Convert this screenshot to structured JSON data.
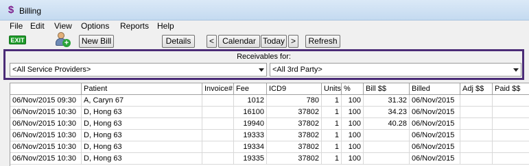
{
  "window": {
    "title": "Billing",
    "icon": "dollar-icon"
  },
  "menu": [
    "File",
    "Edit",
    "View",
    "Options",
    "Reports",
    "Help"
  ],
  "toolbar": {
    "exit_label": "EXIT",
    "new_bill": "New Bill",
    "details": "Details",
    "prev": "<",
    "calendar": "Calendar",
    "today": "Today",
    "next": ">",
    "refresh": "Refresh"
  },
  "filters": {
    "title": "Receivables for:",
    "providers": "<All Service Providers>",
    "third_party": "<All 3rd Party>"
  },
  "colors": {
    "highlight_border": "#4b2c77",
    "exit_green": "#1e9b2a"
  },
  "table": {
    "columns": [
      "",
      "Patient",
      "Invoice#",
      "Fee",
      "ICD9",
      "Units",
      "%",
      "Bill $$",
      "Billed",
      "Adj $$",
      "Paid $$"
    ],
    "rows": [
      [
        "06/Nov/2015 09:30",
        "A, Caryn 67",
        "",
        "1012",
        "780",
        "1",
        "100",
        "31.32",
        "06/Nov/2015",
        "",
        ""
      ],
      [
        "06/Nov/2015 10:30",
        "D, Hong 63",
        "",
        "16100",
        "37802",
        "1",
        "100",
        "34.23",
        "06/Nov/2015",
        "",
        ""
      ],
      [
        "06/Nov/2015 10:30",
        "D, Hong 63",
        "",
        "19940",
        "37802",
        "1",
        "100",
        "40.28",
        "06/Nov/2015",
        "",
        ""
      ],
      [
        "06/Nov/2015 10:30",
        "D, Hong 63",
        "",
        "19333",
        "37802",
        "1",
        "100",
        "",
        "06/Nov/2015",
        "",
        ""
      ],
      [
        "06/Nov/2015 10:30",
        "D, Hong 63",
        "",
        "19334",
        "37802",
        "1",
        "100",
        "",
        "06/Nov/2015",
        "",
        ""
      ],
      [
        "06/Nov/2015 10:30",
        "D, Hong 63",
        "",
        "19335",
        "37802",
        "1",
        "100",
        "",
        "06/Nov/2015",
        "",
        ""
      ]
    ]
  }
}
